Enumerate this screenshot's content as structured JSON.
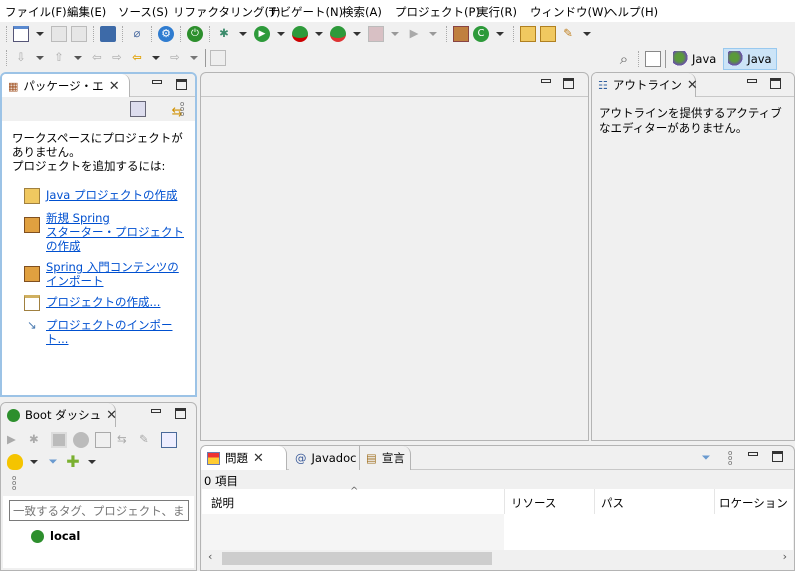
{
  "menu": [
    "ファイル(F)",
    "編集(E)",
    "ソース(S)",
    "リファクタリング(T)",
    "ナビゲート(N)",
    "検索(A)",
    "プロジェクト(P)",
    "実行(R)",
    "ウィンドウ(W)",
    "ヘルプ(H)"
  ],
  "perspectives": [
    {
      "label": "Java",
      "active": false
    },
    {
      "label": "Java",
      "active": true
    }
  ],
  "package_explorer": {
    "title": "パッケージ・エ",
    "message1": "ワークスペースにプロジェクトがありません。",
    "message2": "プロジェクトを追加するには:",
    "links": [
      "Java プロジェクトの作成",
      "新規 Spring\nスターター・プロジェクトの作成",
      "Spring 入門コンテンツの\nインポート",
      "プロジェクトの作成...",
      "プロジェクトのインポート..."
    ]
  },
  "outline": {
    "title": "アウトライン",
    "message": "アウトラインを提供するアクティブなエディターがありません。"
  },
  "boot_dashboard": {
    "title": "Boot ダッシュ",
    "filter_placeholder": "一致するタグ、プロジェクト、またはワーキングセット",
    "items": [
      "local"
    ]
  },
  "bottom": {
    "tabs": [
      "問題",
      "Javadoc",
      "宣言"
    ],
    "count": "0 項目",
    "columns": [
      "説明",
      "リソース",
      "パス",
      "ロケーション"
    ]
  },
  "colors": {
    "link": "#0050d0",
    "spring_green": "#2d8f2d",
    "active_perspective": "#cce4f7"
  }
}
